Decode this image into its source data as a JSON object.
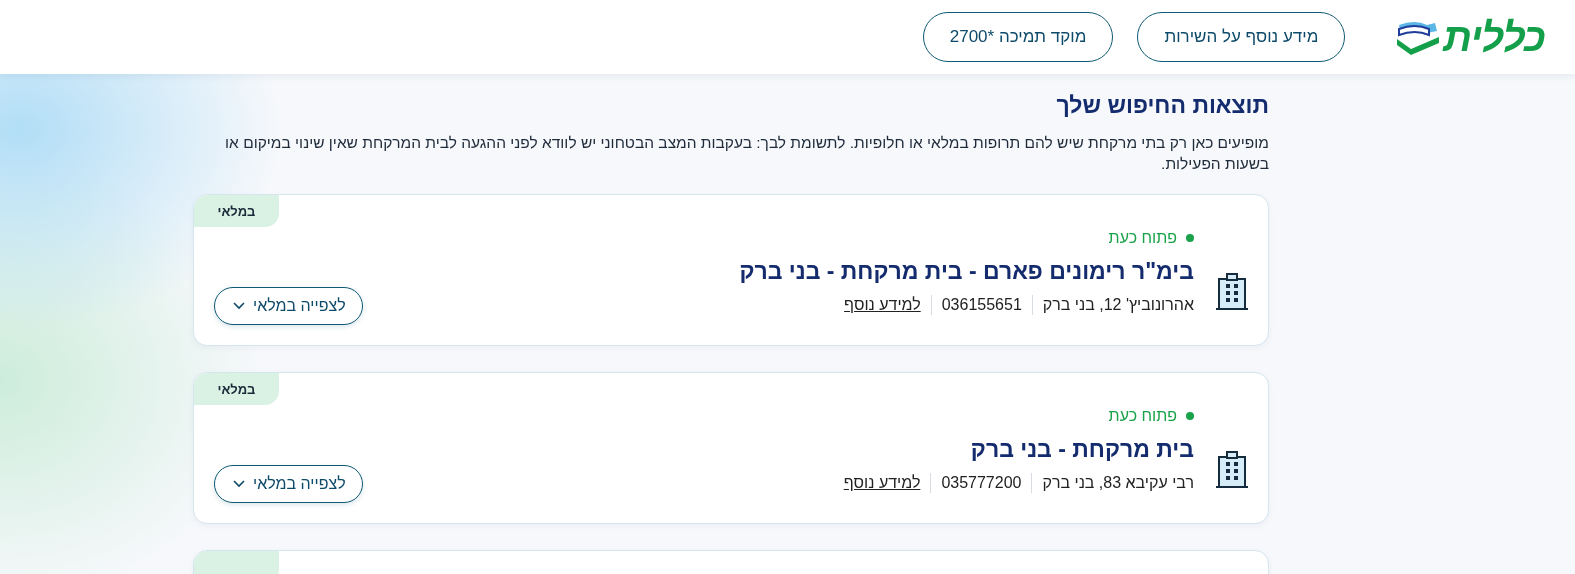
{
  "header": {
    "logo_text": "כללית",
    "buttons": [
      {
        "label": "מידע נוסף על השירות"
      },
      {
        "label": "מוקד תמיכה *2700"
      }
    ]
  },
  "results": {
    "title": "תוצאות החיפוש שלך",
    "note": "מופיעים כאן רק בתי מרקחת שיש להם תרופות במלאי או חלופיות. לתשומת לבך: בעקבות המצב הבטחוני יש לוודא לפני ההגעה לבית המרקחת שאין שינוי במיקום או בשעות הפעילות."
  },
  "pharmacies": [
    {
      "kind": "full",
      "stock_badge": "במלאי",
      "status": "פתוח כעת",
      "open": true,
      "name": "בימ\"ר רימונים פארם - בית מרקחת - בני ברק",
      "address": "אהרונוביץ' 12, בני ברק",
      "phone": "036155651",
      "link": "למידע נוסף",
      "button": "לצפייה במלאי"
    },
    {
      "kind": "full",
      "stock_badge": "במלאי",
      "status": "פתוח כעת",
      "open": true,
      "name": "בית מרקחת - בני ברק",
      "address": "רבי עקיבא 83, בני ברק",
      "phone": "035777200",
      "link": "למידע נוסף",
      "button": "לצפייה במלאי"
    },
    {
      "kind": "partial"
    }
  ]
}
